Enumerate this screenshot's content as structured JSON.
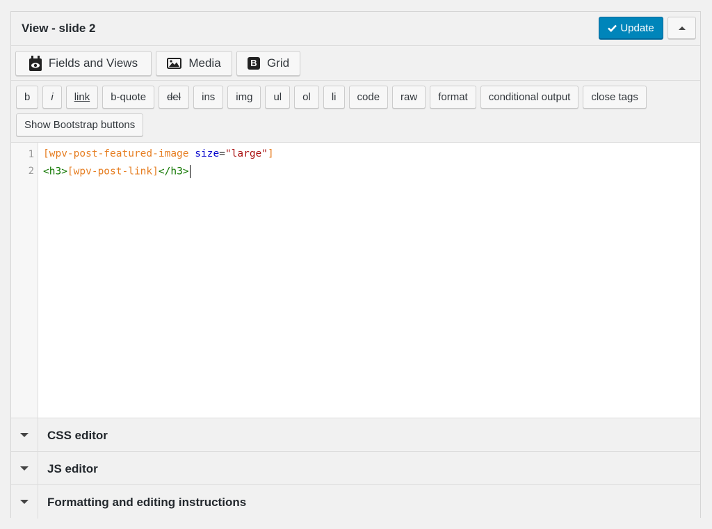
{
  "header": {
    "title": "View - slide 2",
    "update_label": "Update"
  },
  "toolbar": {
    "fields_views_label": "Fields and Views",
    "media_label": "Media",
    "grid_label": "Grid",
    "grid_icon_letter": "B"
  },
  "quicktags": {
    "row1": [
      "b",
      "i",
      "link",
      "b-quote",
      "del",
      "ins",
      "img",
      "ul",
      "ol",
      "li",
      "code",
      "raw",
      "format",
      "conditional output",
      "close tags"
    ],
    "row2": [
      "Show Bootstrap buttons"
    ]
  },
  "editor": {
    "line_numbers": [
      "1",
      "2"
    ],
    "line1": {
      "open": "[wpv-post-featured-image ",
      "attr": "size",
      "eq": "=",
      "value": "\"large\"",
      "close": "]"
    },
    "line2": {
      "tag_open": "<h3>",
      "shortcode": "[wpv-post-link]",
      "tag_close": "</h3>"
    }
  },
  "sections": [
    {
      "label": "CSS editor"
    },
    {
      "label": "JS editor"
    },
    {
      "label": "Formatting and editing instructions"
    }
  ],
  "colors": {
    "primary": "#0085ba",
    "shortcode": "#e67e22",
    "attribute": "#0000cc",
    "string": "#aa1111",
    "tag": "#117700"
  }
}
